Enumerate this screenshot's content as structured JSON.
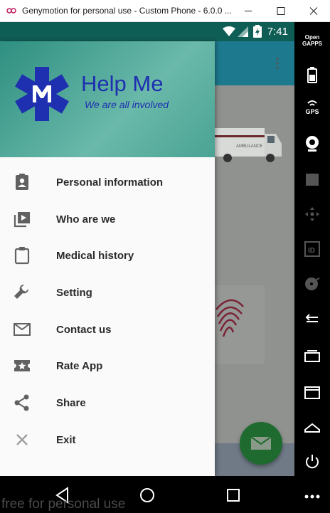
{
  "window": {
    "title": "Genymotion for personal use - Custom Phone - 6.0.0 ...",
    "minimize_icon": "minimize-icon",
    "maximize_icon": "maximize-icon",
    "close_icon": "close-icon"
  },
  "status_bar": {
    "time": "7:41",
    "icons": [
      "wifi-icon",
      "cell-signal-icon",
      "battery-charging-icon"
    ]
  },
  "drawer": {
    "header": {
      "title": "Help Me",
      "tagline": "We are all involved",
      "logo_icon": "star-of-life-logo"
    },
    "items": [
      {
        "label": "Personal information",
        "icon": "clipboard-person-icon"
      },
      {
        "label": "Who are we",
        "icon": "video-library-icon"
      },
      {
        "label": "Medical history",
        "icon": "clipboard-icon"
      },
      {
        "label": "Setting",
        "icon": "wrench-icon"
      },
      {
        "label": "Contact us",
        "icon": "mail-icon"
      },
      {
        "label": "Rate App",
        "icon": "ticket-star-icon"
      },
      {
        "label": "Share",
        "icon": "share-icon"
      },
      {
        "label": "Exit",
        "icon": "close-icon"
      }
    ]
  },
  "background_app": {
    "ambulance_text": "AMBULANCE",
    "fab_icon": "mail-icon",
    "overflow_icon": "more-vertical-icon"
  },
  "nav_bar": {
    "buttons": [
      "back-icon",
      "home-icon",
      "recents-icon"
    ]
  },
  "watermark": "free for personal use",
  "genymotion_sidebar": {
    "opengapps_label": "Open GAPPS",
    "gps_label": "GPS",
    "buttons": [
      "opengapps-icon",
      "battery-icon",
      "gps-icon",
      "webcam-icon",
      "video-icon",
      "dpad-icon",
      "id-icon",
      "disk-icon",
      "back-icon",
      "recents-icon",
      "menu-icon",
      "home-icon",
      "power-icon",
      "more-icon"
    ]
  },
  "colors": {
    "status_bar": "#0f5e55",
    "drawer_header": "#2e8f80",
    "brand_text": "#1e2fb0",
    "fab": "#1f6b2f",
    "app_bar": "#1d7a8e"
  }
}
